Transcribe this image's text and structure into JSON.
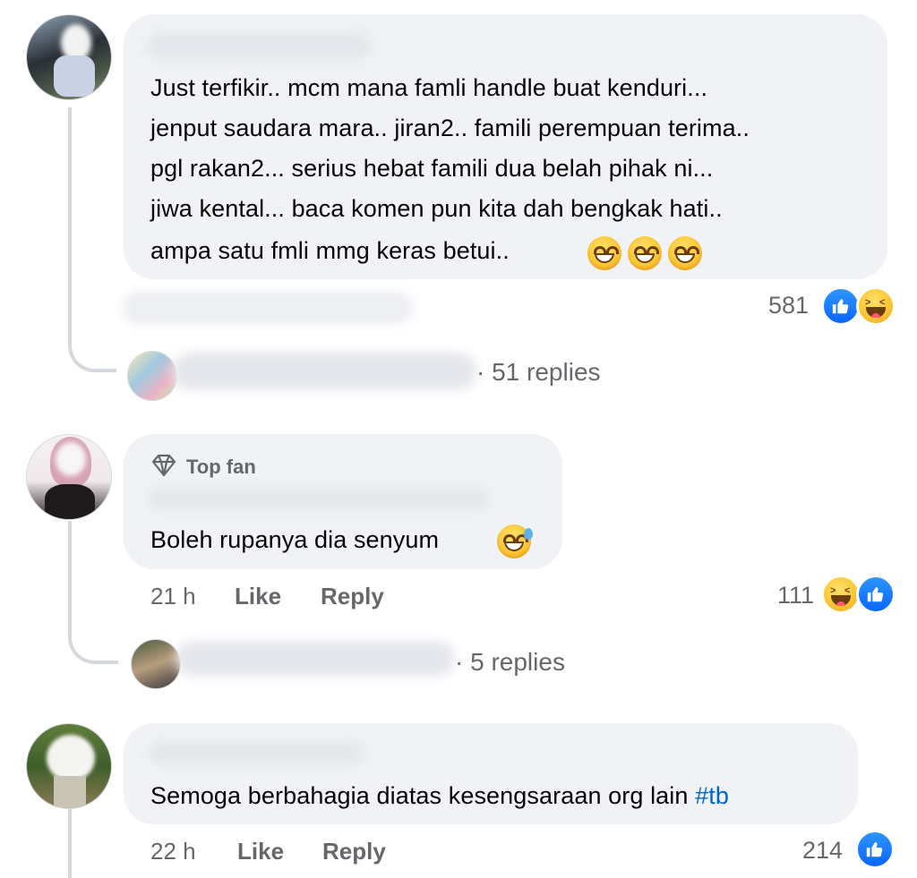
{
  "comments": [
    {
      "lines": [
        "Just terfikir.. mcm mana famli handle buat kenduri...",
        "jenput saudara mara.. jiran2.. famili perempuan terima..",
        "pgl rakan2... serius hebat famili dua belah pihak ni...",
        "jiwa kental... baca komen pun kita dah bengkak hati..",
        "ampa satu fmli mmg keras betui.."
      ],
      "trailing_emojis": [
        "grinning-face",
        "grinning-face",
        "grinning-face"
      ],
      "reaction_count": "581",
      "reactions": [
        "like",
        "haha"
      ],
      "replies_label": "· 51 replies"
    },
    {
      "badge": "Top fan",
      "text": "Boleh rupanya dia senyum",
      "trailing_emojis": [
        "grinning-sweat-face"
      ],
      "time": "21 h",
      "like_label": "Like",
      "reply_label": "Reply",
      "reaction_count": "111",
      "reactions": [
        "haha",
        "like"
      ],
      "replies_label": "· 5 replies"
    },
    {
      "text": "Semoga berbahagia diatas kesengsaraan org lain",
      "hashtag": "#tb",
      "time": "22 h",
      "like_label": "Like",
      "reply_label": "Reply",
      "reaction_count": "214",
      "reactions": [
        "like"
      ]
    }
  ],
  "colors": {
    "bubble": "#f0f2f5",
    "meta_text": "#65676b",
    "hashtag": "#0064d1",
    "like_blue": "#0866ff"
  }
}
